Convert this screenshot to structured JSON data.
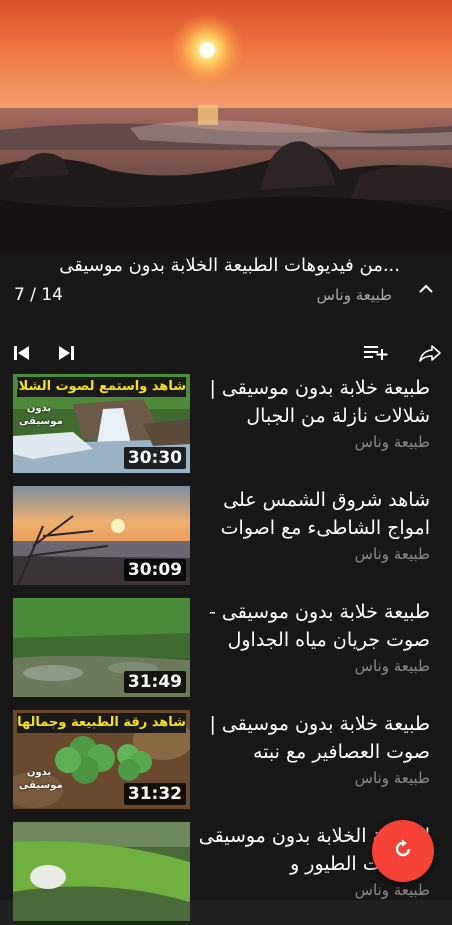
{
  "playlist": {
    "title": "...من فيديوهات الطبيعة الخلابة بدون موسيقى",
    "channel": "طبيعة وناس",
    "position": "7 / 14"
  },
  "items": [
    {
      "title": "طبيعة خلابة بدون موسيقى | شلالات نازلة من الجبال",
      "channel": "طبيعة وناس",
      "duration": "30:30",
      "badge_top": "شاهد واستمع لصوت الشلال",
      "badge_side": "بدون موسيقى"
    },
    {
      "title": "شاهد شروق الشمس على امواج الشاطىء مع اصوات",
      "channel": "طبيعة وناس",
      "duration": "30:09"
    },
    {
      "title": "طبيعة خلابة بدون موسيقى - صوت جريان مياه الجداول",
      "channel": "طبيعة وناس",
      "duration": "31:49"
    },
    {
      "title": "طبيعة خلابة بدون موسيقى | صوت العصافير مع نبته",
      "channel": "طبيعة وناس",
      "duration": "31:32",
      "badge_top": "شاهد رقة الطبيعة وجمالها",
      "badge_side": "بدون موسيقى"
    },
    {
      "title": "الطبيعة الخلابة بدون موسيقى - اصوات الطيور و",
      "channel": "طبيعة وناس",
      "duration": ""
    }
  ],
  "icons": {
    "collapse": "chevron-up-icon",
    "previous": "skip-previous-icon",
    "next": "skip-next-icon",
    "save": "playlist-add-icon",
    "share": "share-icon",
    "fab": "refresh-icon"
  },
  "colors": {
    "background": "#181818",
    "fab": "#f44336",
    "badge_text": "#f5e11b"
  }
}
